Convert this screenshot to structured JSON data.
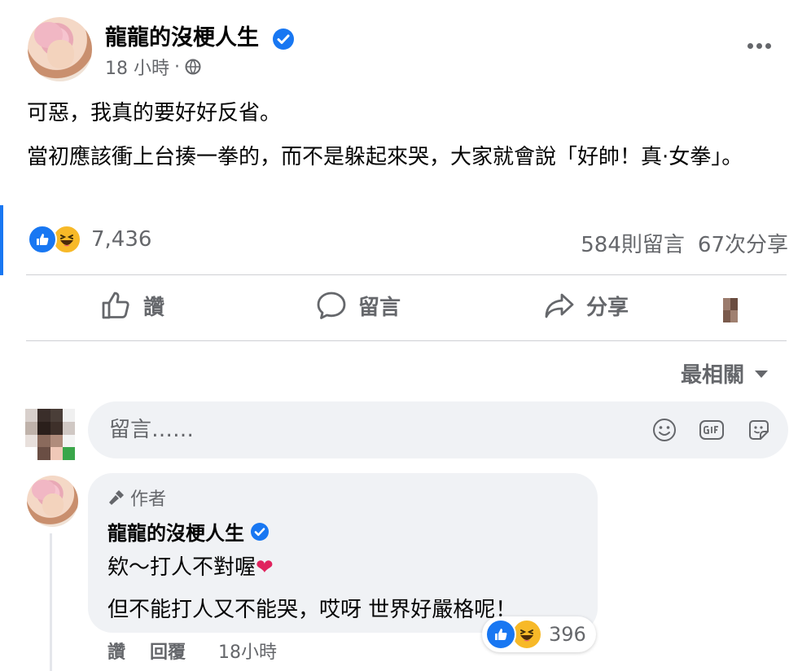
{
  "post": {
    "author": "龍龍的沒梗人生",
    "time": "18 小時",
    "meta_separator": "·",
    "paragraphs": [
      "可惡，我真的要好好反省。",
      "當初應該衝上台揍一拳的，而不是躲起來哭，大家就會說「好帥！真·女拳」。"
    ],
    "reaction_count": "7,436",
    "comment_count": "584則留言",
    "share_count": "67次分享"
  },
  "actions": {
    "like": "讚",
    "comment": "留言",
    "share": "分享"
  },
  "sort": {
    "label": "最相關"
  },
  "comment_input": {
    "placeholder": "留言……"
  },
  "reply": {
    "badge": "作者",
    "author": "龍龍的沒梗人生",
    "lines": [
      "欸～打人不對喔",
      "但不能打人又不能哭，哎呀 世界好嚴格呢！"
    ],
    "reaction_count": "396",
    "like_action": "讚",
    "reply_action": "回覆",
    "time": "18小時"
  },
  "colors": {
    "brand_blue": "#1877f2",
    "haha_yellow": "#f7b928",
    "secondary_text": "#65676b",
    "bubble_bg": "#f0f2f5",
    "heart_red": "#e0245e"
  }
}
